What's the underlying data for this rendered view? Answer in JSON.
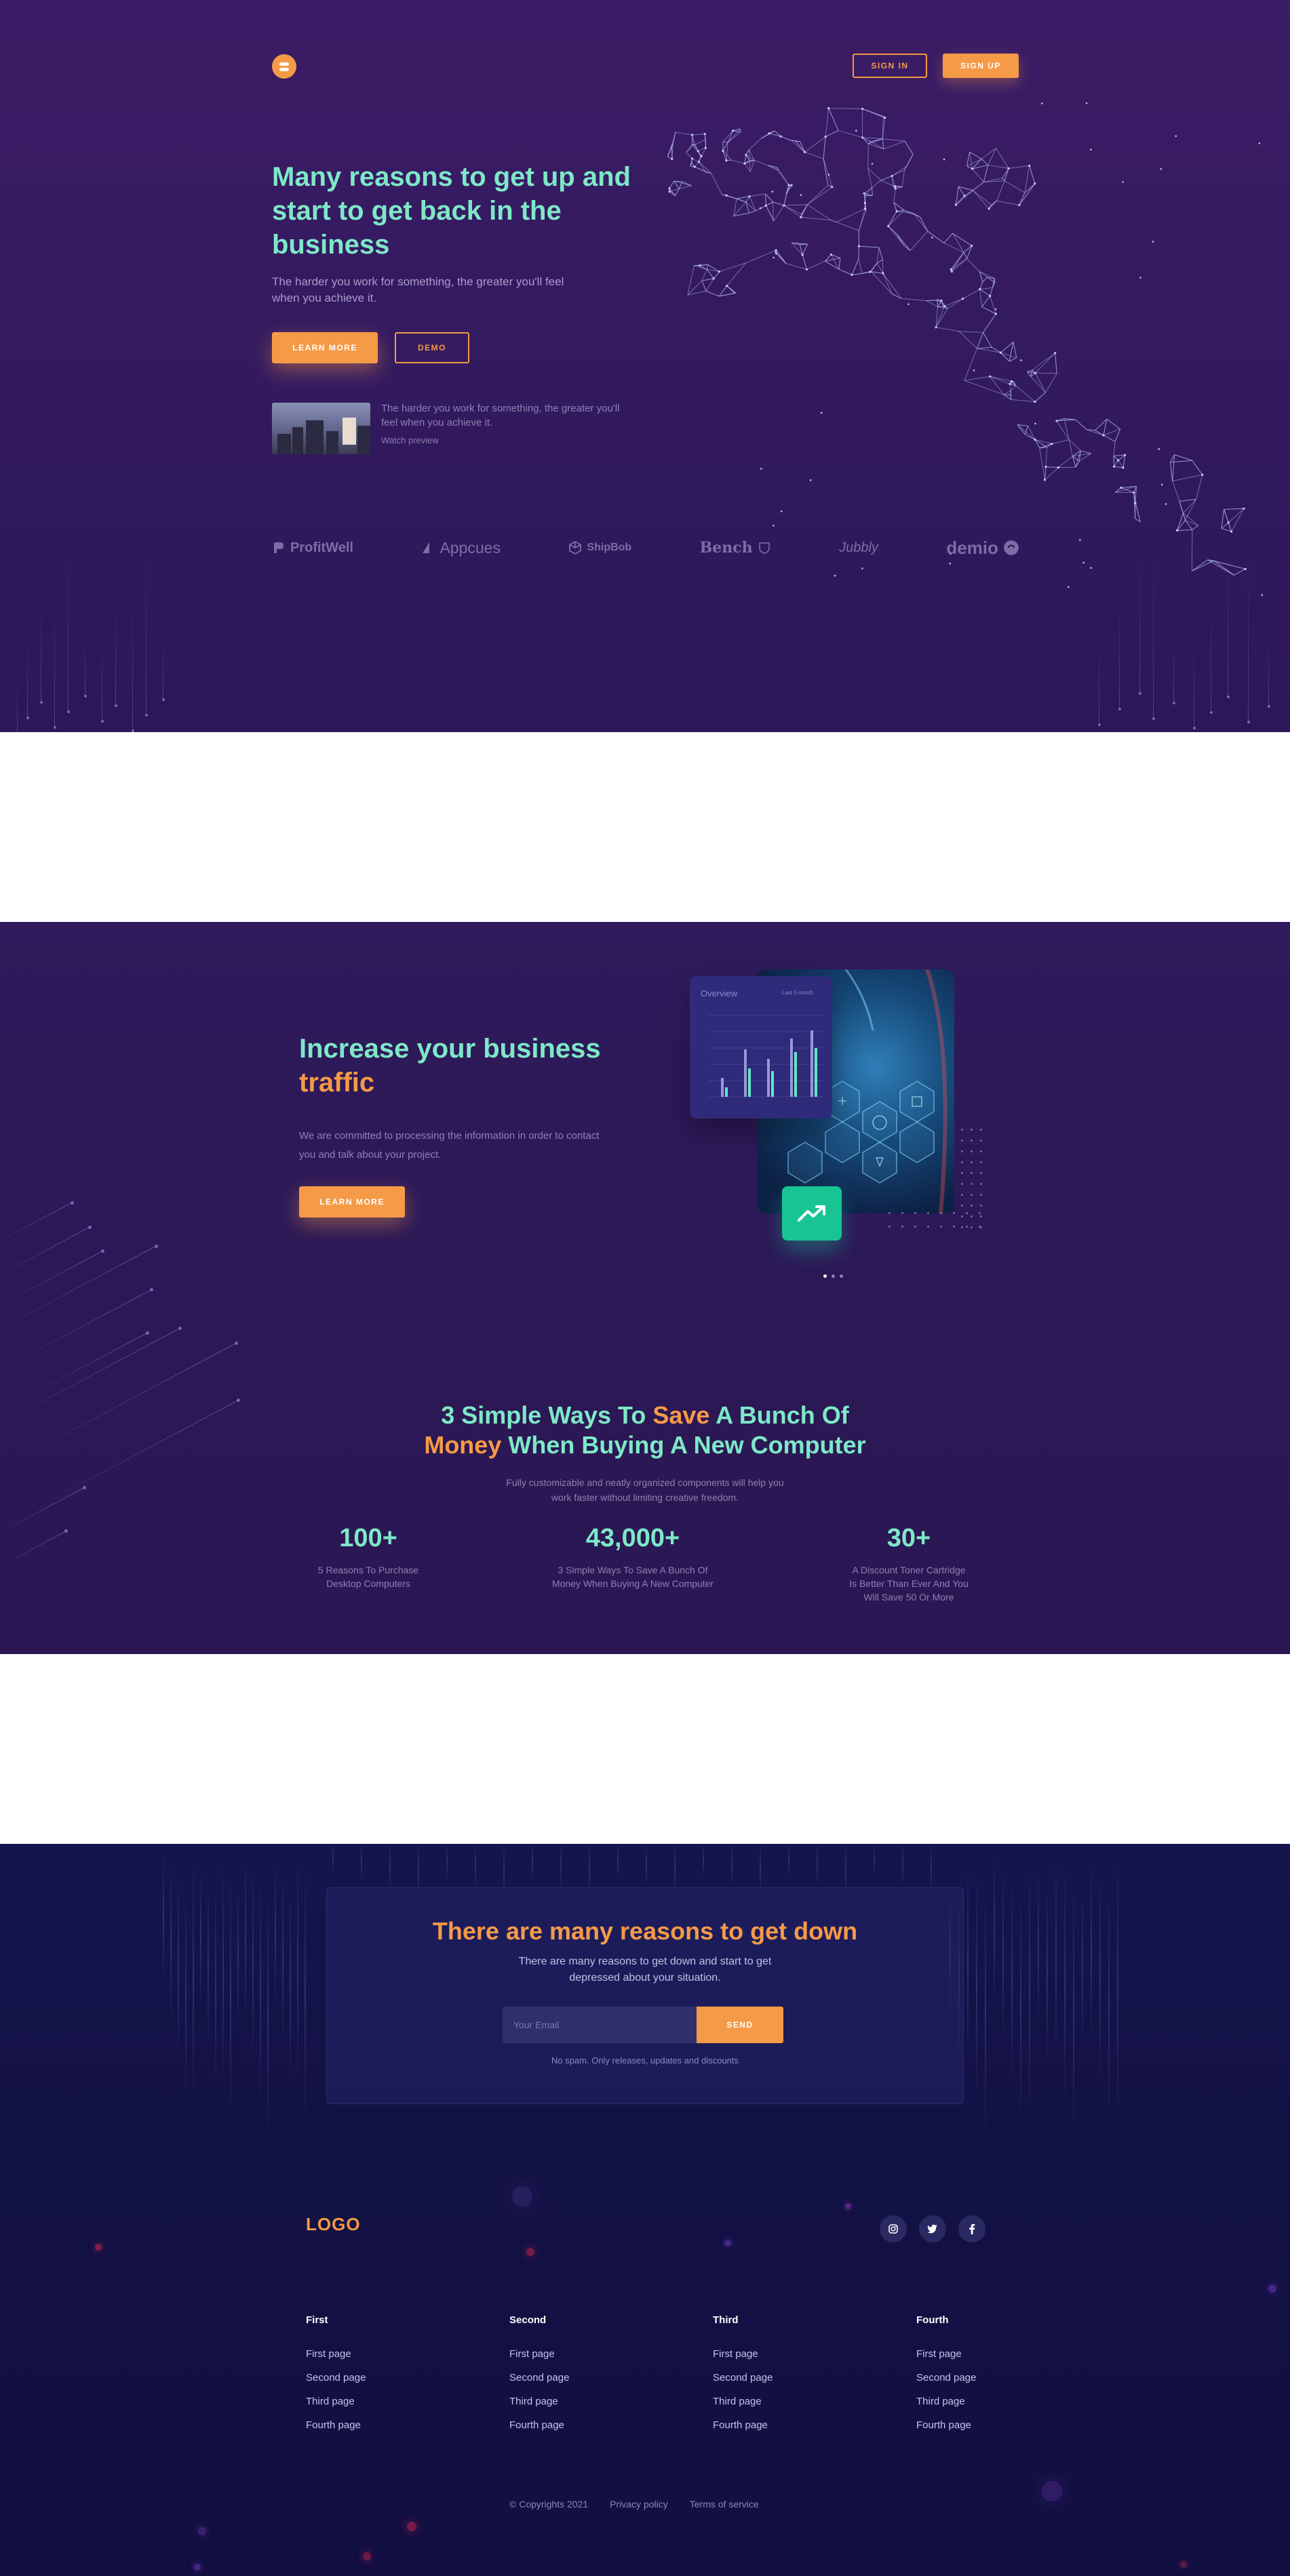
{
  "header": {
    "sign_in": "SIGN IN",
    "sign_up": "SIGN UP"
  },
  "hero": {
    "title": "Many reasons to get up and start to get back in the business",
    "subtitle": "The harder you work for something, the greater you'll feel when you achieve it.",
    "learn_more": "LEARN MORE",
    "demo": "DEMO",
    "preview_text": "The harder you work for something, the greater you'll feel when you achieve it.",
    "preview_link": "Watch preview"
  },
  "partners": [
    "ProfitWell",
    "Appcues",
    "ShipBob",
    "Bench",
    "Jubbly",
    "demio"
  ],
  "traffic": {
    "title_main": "Increase your business",
    "title_accent": "traffic",
    "text": "We are committed to processing the information in order to contact you and talk about your project.",
    "button": "LEARN MORE",
    "card_title": "Overview",
    "card_sub": "Last 5 month"
  },
  "ways": {
    "h_part1": "3 Simple Ways To ",
    "h_save": "Save",
    "h_part2": " A Bunch Of",
    "h_money": "Money",
    "h_part3": " When Buying A New Computer",
    "subtitle": "Fully customizable and neatly organized components will help you work faster without limiting creative freedom.",
    "stats": [
      {
        "value": "100+",
        "label": "5 Reasons To Purchase Desktop Computers"
      },
      {
        "value": "43,000+",
        "label": "3 Simple Ways To Save A Bunch Of Money When Buying A New Computer"
      },
      {
        "value": "30+",
        "label": "A Discount Toner Cartridge Is Better Than Ever And You Will Save 50 Or More"
      }
    ]
  },
  "newsletter": {
    "title": "There are many reasons to get down",
    "text": "There are many reasons to get down and start to get depressed about your situation.",
    "placeholder": "Your Email",
    "send": "SEND",
    "note": "No spam. Only releases, updates and discounts"
  },
  "footer": {
    "logo": "LOGO",
    "columns": [
      {
        "title": "First",
        "links": [
          "First page",
          "Second page",
          "Third page",
          "Fourth page"
        ]
      },
      {
        "title": "Second",
        "links": [
          "First page",
          "Second page",
          "Third page",
          "Fourth page"
        ]
      },
      {
        "title": "Third",
        "links": [
          "First page",
          "Second page",
          "Third page",
          "Fourth page"
        ]
      },
      {
        "title": "Fourth",
        "links": [
          "First page",
          "Second page",
          "Third page",
          "Fourth page"
        ]
      }
    ],
    "copyright": "© Copyrights 2021",
    "privacy": "Privacy policy",
    "terms": "Terms of service",
    "social": [
      "instagram-icon",
      "twitter-icon",
      "facebook-icon"
    ]
  },
  "colors": {
    "accent": "#f59a47",
    "mint": "#7ee8c7",
    "hero_bg": "#3b1c66",
    "footer_bg": "#131245",
    "badge_green": "#19c494"
  }
}
